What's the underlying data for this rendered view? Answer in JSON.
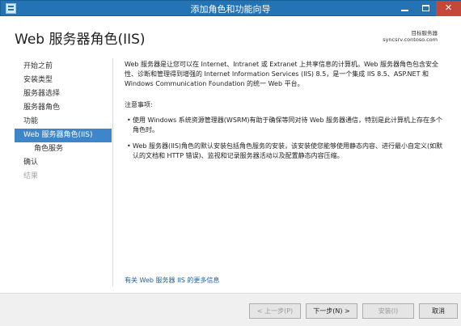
{
  "window": {
    "title": "添加角色和功能向导",
    "minimize": "minimize",
    "maximize": "maximize",
    "close": "✕"
  },
  "header": {
    "page_title": "Web 服务器角色(IIS)",
    "server_role_label": "目标服务器",
    "server_name": "syncsrv.contoso.com"
  },
  "nav": {
    "items": [
      {
        "label": "开始之前",
        "state": "normal"
      },
      {
        "label": "安装类型",
        "state": "normal"
      },
      {
        "label": "服务器选择",
        "state": "normal"
      },
      {
        "label": "服务器角色",
        "state": "normal"
      },
      {
        "label": "功能",
        "state": "normal"
      },
      {
        "label": "Web 服务器角色(IIS)",
        "state": "active"
      },
      {
        "label": "角色服务",
        "state": "sub"
      },
      {
        "label": "确认",
        "state": "normal"
      },
      {
        "label": "结果",
        "state": "disabled"
      }
    ]
  },
  "content": {
    "intro": "Web 服务器是让您可以在 Internet、Intranet 或 Extranet 上共享信息的计算机。Web 服务器角色包含安全性、诊断和管理得到增强的 Internet Information Services (IIS) 8.5，是一个集成 IIS 8.5、ASP.NET 和 Windows Communication Foundation 的统一 Web 平台。",
    "notes_title": "注意事项:",
    "bullets": [
      "使用 Windows 系统资源管理器(WSRM)有助于确保等同对待 Web 服务器通信，特别是此计算机上存在多个角色时。",
      "Web 服务器(IIS)角色的默认安装包括角色服务的安装，该安装使您能够使用静态内容、进行最小自定义(如默认的文档和 HTTP 错误)、监视和记录服务器活动以及配置静态内容压缩。"
    ],
    "bullet_glyph": "•",
    "more_info_link": "有关 Web 服务器 IIS 的更多信息"
  },
  "footer": {
    "prev": "< 上一步(P)",
    "next": "下一步(N) >",
    "install": "安装(I)",
    "cancel": "取消"
  },
  "colors": {
    "titlebar": "#2474b5",
    "nav_active": "#3c86c9",
    "link": "#1f5fa8",
    "close_button": "#c7463b"
  }
}
